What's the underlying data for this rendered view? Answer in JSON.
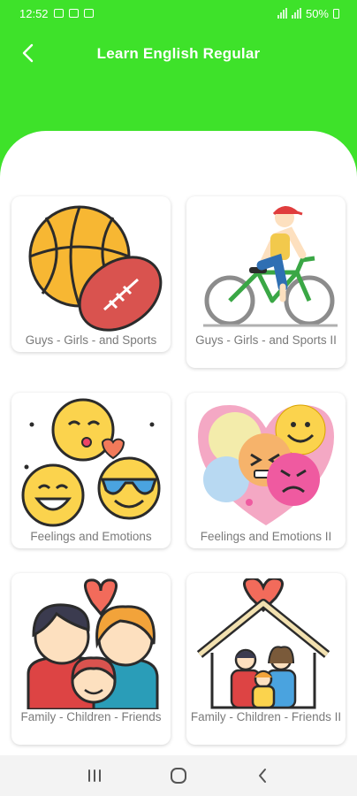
{
  "status_bar": {
    "time": "12:52",
    "battery": "50%"
  },
  "header": {
    "title": "Learn English Regular"
  },
  "cards": [
    {
      "label": "Guys - Girls - and Sports",
      "icon": "sports-balls-icon"
    },
    {
      "label": "Guys - Girls - and Sports II",
      "icon": "cyclist-icon"
    },
    {
      "label": "Feelings and Emotions",
      "icon": "emoji-faces-icon"
    },
    {
      "label": "Feelings and Emotions II",
      "icon": "emotions-heart-icon"
    },
    {
      "label": "Family - Children - Friends",
      "icon": "family-icon"
    },
    {
      "label": "Family - Children - Friends II",
      "icon": "family-house-icon"
    }
  ],
  "colors": {
    "accent": "#3ee22a",
    "card_bg": "#ffffff",
    "label": "#7a7a7a"
  }
}
